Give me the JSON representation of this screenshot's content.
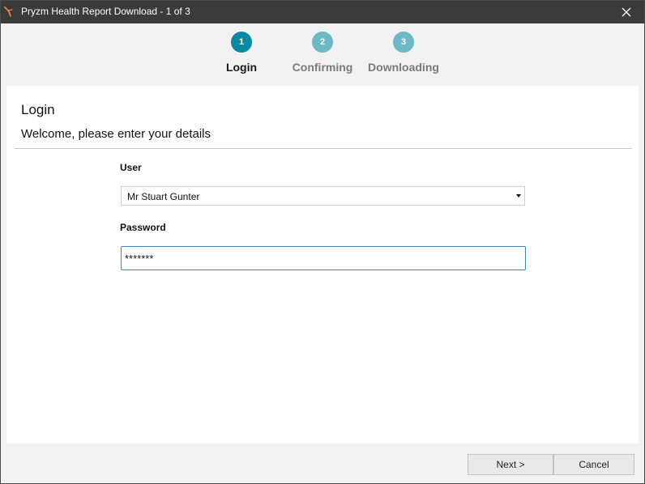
{
  "window": {
    "title": "Pryzm Health Report Download - 1 of 3",
    "app_icon": "pryzm-logo-icon",
    "close_icon": "close-icon"
  },
  "steps": [
    {
      "number": "1",
      "label": "Login",
      "state": "active"
    },
    {
      "number": "2",
      "label": "Confirming",
      "state": "inactive"
    },
    {
      "number": "3",
      "label": "Downloading",
      "state": "inactive"
    }
  ],
  "colors": {
    "titlebar": "#3b3b3b",
    "step_active": "#0a8aa1",
    "step_inactive": "#6cb9c6",
    "input_focus_border": "#3d86c6"
  },
  "panel": {
    "title": "Login",
    "subtitle": "Welcome, please enter your details"
  },
  "form": {
    "user_label": "User",
    "user_value": "Mr Stuart Gunter",
    "password_label": "Password",
    "password_value": "*******"
  },
  "footer": {
    "next_label": "Next >",
    "cancel_label": "Cancel"
  }
}
